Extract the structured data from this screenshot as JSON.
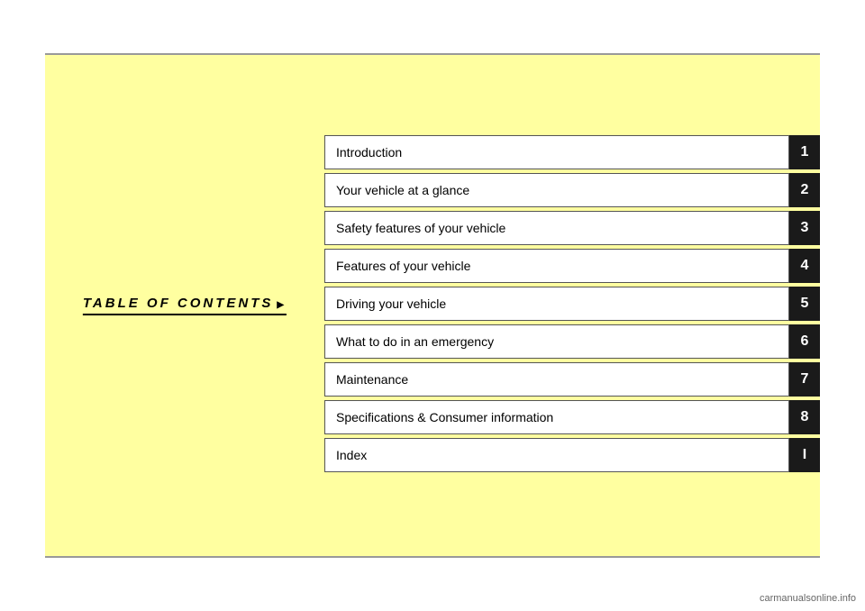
{
  "page": {
    "title": "TABLE OF CONTENTS",
    "toc_items": [
      {
        "id": 1,
        "label": "Introduction",
        "number": "1"
      },
      {
        "id": 2,
        "label": "Your vehicle at a glance",
        "number": "2"
      },
      {
        "id": 3,
        "label": "Safety features of your vehicle",
        "number": "3"
      },
      {
        "id": 4,
        "label": "Features of your vehicle",
        "number": "4"
      },
      {
        "id": 5,
        "label": "Driving your vehicle",
        "number": "5"
      },
      {
        "id": 6,
        "label": "What to do in an emergency",
        "number": "6"
      },
      {
        "id": 7,
        "label": "Maintenance",
        "number": "7"
      },
      {
        "id": 8,
        "label": "Specifications & Consumer information",
        "number": "8"
      },
      {
        "id": 9,
        "label": "Index",
        "number": "I"
      }
    ],
    "watermark": "carmanualsonline.info"
  }
}
